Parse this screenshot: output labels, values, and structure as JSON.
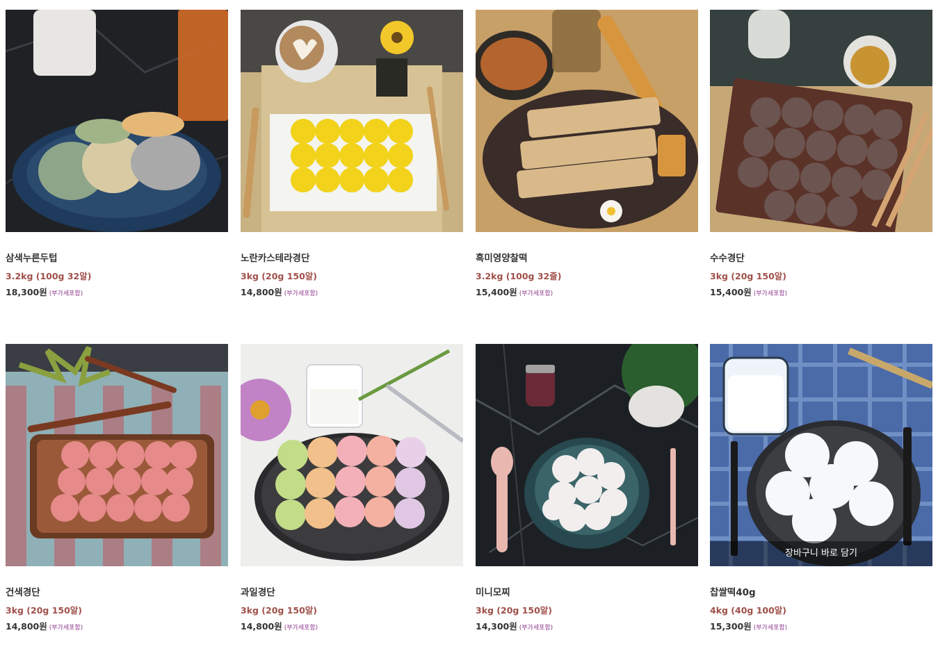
{
  "products": [
    {
      "name": "삼색누른두텁",
      "spec": "3.2kg (100g 32알)",
      "price": "18,300원",
      "vat": "(부가세포함)",
      "image": "tricolor-rice-cakes-on-dark-marble"
    },
    {
      "name": "노란카스테라경단",
      "spec": "3kg (20g 150알)",
      "price": "14,800원",
      "vat": "(부가세포함)",
      "image": "yellow-castella-balls-with-coffee"
    },
    {
      "name": "흑미영양찰떡",
      "spec": "3.2kg (100g 32줄)",
      "price": "15,400원",
      "vat": "(부가세포함)",
      "image": "nut-bars-on-plate-with-almonds"
    },
    {
      "name": "수수경단",
      "spec": "3kg (20g 150알)",
      "price": "15,400원",
      "vat": "(부가세포함)",
      "image": "sorghum-balls-on-wooden-tray"
    },
    {
      "name": "건색경단",
      "spec": "3kg (20g 150알)",
      "price": "14,800원",
      "vat": "(부가세포함)",
      "image": "pink-balls-on-wooden-tray"
    },
    {
      "name": "과일경단",
      "spec": "3kg (20g 150알)",
      "price": "14,800원",
      "vat": "(부가세포함)",
      "image": "pastel-fruit-balls-on-plate"
    },
    {
      "name": "미니모찌",
      "spec": "3kg (20g 150알)",
      "price": "14,300원",
      "vat": "(부가세포함)",
      "image": "white-mochi-in-teal-bowl"
    },
    {
      "name": "찹쌀떡40g",
      "spec": "4kg (40g 100알)",
      "price": "15,300원",
      "vat": "(부가세포함)",
      "image": "white-rice-cakes-on-blue-gingham",
      "overlay": "장바구니 바로 담기"
    }
  ]
}
